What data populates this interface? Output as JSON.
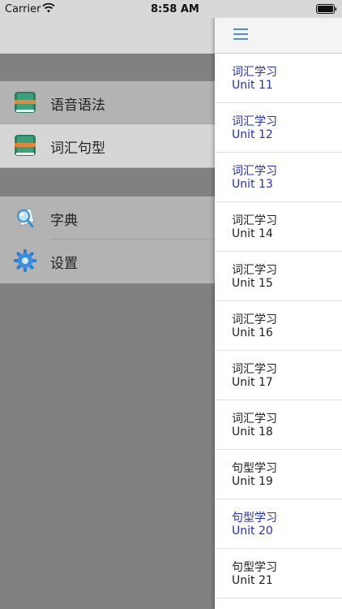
{
  "status_bar": {
    "carrier": "Carrier",
    "time": "8:58 AM"
  },
  "menu": {
    "group1": [
      {
        "label": "语音语法",
        "icon": "book-icon",
        "selected": false
      },
      {
        "label": "词汇句型",
        "icon": "book-icon",
        "selected": true
      }
    ],
    "group2": [
      {
        "label": "字典",
        "icon": "dictionary-search-icon"
      },
      {
        "label": "设置",
        "icon": "gear-icon"
      }
    ]
  },
  "units": [
    {
      "title": "词汇学习",
      "unit": "Unit 11",
      "visited": true
    },
    {
      "title": "词汇学习",
      "unit": "Unit 12",
      "visited": true
    },
    {
      "title": "词汇学习",
      "unit": "Unit 13",
      "visited": true
    },
    {
      "title": "词汇学习",
      "unit": "Unit 14",
      "visited": false
    },
    {
      "title": "词汇学习",
      "unit": "Unit 15",
      "visited": false
    },
    {
      "title": "词汇学习",
      "unit": "Unit 16",
      "visited": false
    },
    {
      "title": "词汇学习",
      "unit": "Unit 17",
      "visited": false
    },
    {
      "title": "词汇学习",
      "unit": "Unit 18",
      "visited": false
    },
    {
      "title": "句型学习",
      "unit": "Unit 19",
      "visited": false
    },
    {
      "title": "句型学习",
      "unit": "Unit 20",
      "visited": true
    },
    {
      "title": "句型学习",
      "unit": "Unit 21",
      "visited": false
    }
  ],
  "colors": {
    "visited_link": "#2630b8",
    "hamburger": "#4a90d9"
  }
}
